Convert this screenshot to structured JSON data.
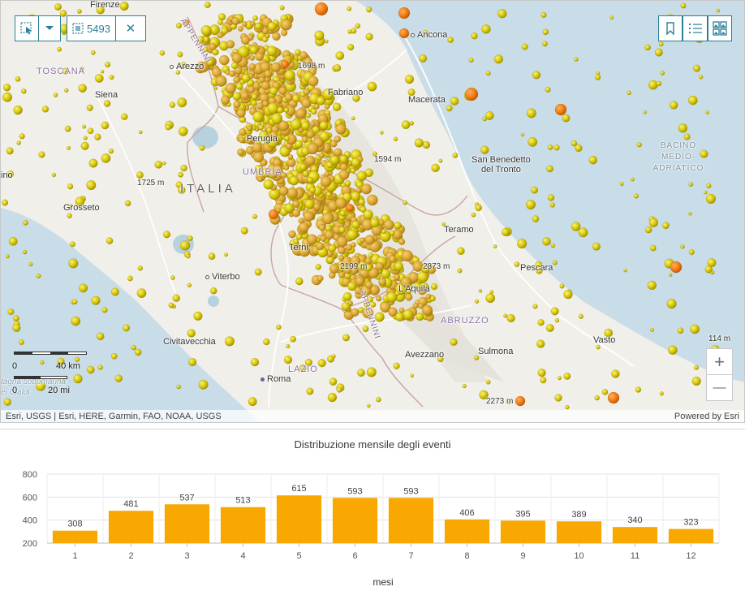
{
  "map": {
    "toolbar": {
      "selection_count": "5493",
      "clear_symbol": "✕"
    },
    "icons": {
      "select": "select-tool-icon",
      "menu": "chevron-down-icon",
      "selection": "selection-icon",
      "bookmark": "bookmark-icon",
      "legend": "legend-list-icon",
      "basemap": "basemap-gallery-icon",
      "zoom_in": "plus-icon",
      "zoom_out": "minus-icon"
    },
    "zoom_in_symbol": "+",
    "zoom_out_symbol": "—",
    "labels": {
      "toscana": "TOSCANA",
      "umbria": "UMBRIA",
      "lazio": "LAZIO",
      "abruzzo": "ABRUZZO",
      "italia": "ITALIA",
      "sea_1": "BACINO",
      "sea_2": "MEDIO-",
      "sea_3": "ADRIATICO",
      "appennini_1": "APPENNINI",
      "appennini_2": "APPENNINI",
      "firenze": "Firenze",
      "arezzo": "Arezzo",
      "siena": "Siena",
      "grosseto": "Grosseto",
      "perugia": "Perugia",
      "fabriano": "Fabriano",
      "ancona": "Ancona",
      "macerata": "Macerata",
      "san_benedetto_1": "San Benedetto",
      "san_benedetto_2": "del Tronto",
      "teramo": "Teramo",
      "pescara": "Pescara",
      "terni": "Terni",
      "viterbo": "Viterbo",
      "laquila": "L'Aquila",
      "civitavecchia": "Civitavecchia",
      "avezzano": "Avezzano",
      "sulmona": "Sulmona",
      "roma": "Roma",
      "vasto": "Vasto",
      "piombino": "ino",
      "e1698": "1698 m",
      "e1594": "1594 m",
      "e1725": "1725 m",
      "e2199": "2199 m",
      "e2873": "2873 m",
      "e2273": "2273 m",
      "e114": "114 m",
      "montagna_1": "tagna sottomarina",
      "montagna_2": "ei Cialdi"
    },
    "scalebar": {
      "km_start": "0",
      "km_end": "40 km",
      "mi_start": "0",
      "mi_end": "20 mi"
    },
    "attribution_left": "Esri, USGS | Esri, HERE, Garmin, FAO, NOAA, USGS",
    "attribution_right": "Powered by Esri"
  },
  "chart_data": {
    "type": "bar",
    "title": "Distribuzione mensile degli eventi",
    "xlabel": "mesi",
    "ylabel": "",
    "categories": [
      "1",
      "2",
      "3",
      "4",
      "5",
      "6",
      "7",
      "8",
      "9",
      "10",
      "11",
      "12"
    ],
    "values": [
      308,
      481,
      537,
      513,
      615,
      593,
      593,
      406,
      395,
      389,
      340,
      323
    ],
    "ylim": [
      200,
      800
    ],
    "yticks": [
      200,
      400,
      600,
      800
    ],
    "grid": true,
    "bar_color": "#f8a800"
  }
}
